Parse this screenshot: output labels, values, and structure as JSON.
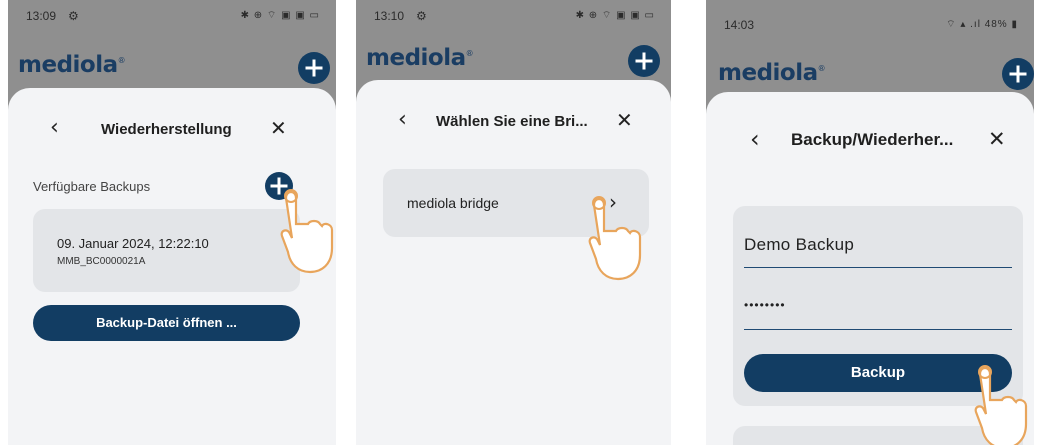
{
  "screens": [
    {
      "status": {
        "time": "13:09",
        "icons": "✱ ⊕ ⌔ ▣ ▣ ▭"
      },
      "logo": "mediola",
      "header": {
        "title": "Wiederherstellung"
      },
      "section_label": "Verfügbare Backups",
      "backup_item": {
        "date": "09. Januar 2024, 12:22:10",
        "id": "MMB_BC0000021A"
      },
      "open_button": "Backup-Datei öffnen ..."
    },
    {
      "status": {
        "time": "13:10",
        "icons": "✱ ⊕ ⌔ ▣ ▣ ▭"
      },
      "logo": "mediola",
      "header": {
        "title": "Wählen Sie eine Bri..."
      },
      "list_item": {
        "label": "mediola bridge"
      }
    },
    {
      "status": {
        "time": "14:03",
        "icons": "⌔ ▴ .ıl 48% ▮"
      },
      "logo": "mediola",
      "header": {
        "title": "Backup/Wiederher..."
      },
      "name_field": {
        "value": "Demo Backup"
      },
      "password_field": {
        "value": "••••••••"
      },
      "backup_button": "Backup"
    }
  ],
  "colors": {
    "primary": "#123d63",
    "sheet": "#f3f4f6",
    "card": "#e3e5e8",
    "overlay": "#8f8f8f",
    "hand": "#e8a55c"
  }
}
